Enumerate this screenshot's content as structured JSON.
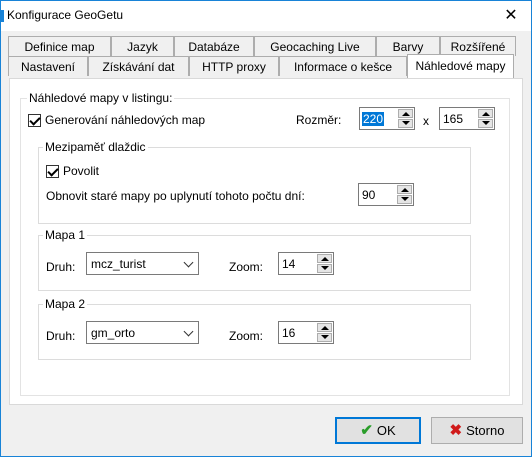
{
  "window": {
    "title": "Konfigurace GeoGetu",
    "close_glyph": "✕"
  },
  "tabs_back": [
    {
      "label": "Definice map"
    },
    {
      "label": "Jazyk"
    },
    {
      "label": "Databáze"
    },
    {
      "label": "Geocaching Live"
    },
    {
      "label": "Barvy"
    },
    {
      "label": "Rozšířené"
    }
  ],
  "tabs_front": [
    {
      "label": "Nastavení"
    },
    {
      "label": "Získávání dat"
    },
    {
      "label": "HTTP proxy"
    },
    {
      "label": "Informace o kešce"
    },
    {
      "label": "Náhledové mapy",
      "active": true
    }
  ],
  "main": {
    "group_title": "Náhledové mapy v listingu:",
    "generate_label": "Generování náhledových map",
    "generate_checked": true,
    "size_label": "Rozměr:",
    "size_width": "220",
    "size_sep": "x",
    "size_height": "165",
    "cache": {
      "title": "Mezipaměť dlaždic",
      "enable_label": "Povolit",
      "enable_checked": true,
      "refresh_label": "Obnovit staré mapy po uplynutí tohoto počtu dní:",
      "refresh_days": "90"
    },
    "map1": {
      "title": "Mapa 1",
      "type_label": "Druh:",
      "type_value": "mcz_turist",
      "zoom_label": "Zoom:",
      "zoom_value": "14"
    },
    "map2": {
      "title": "Mapa 2",
      "type_label": "Druh:",
      "type_value": "gm_orto",
      "zoom_label": "Zoom:",
      "zoom_value": "16"
    }
  },
  "footer": {
    "ok_label": "OK",
    "ok_icon": "check-icon",
    "cancel_label": "Storno",
    "cancel_icon": "x-icon"
  }
}
